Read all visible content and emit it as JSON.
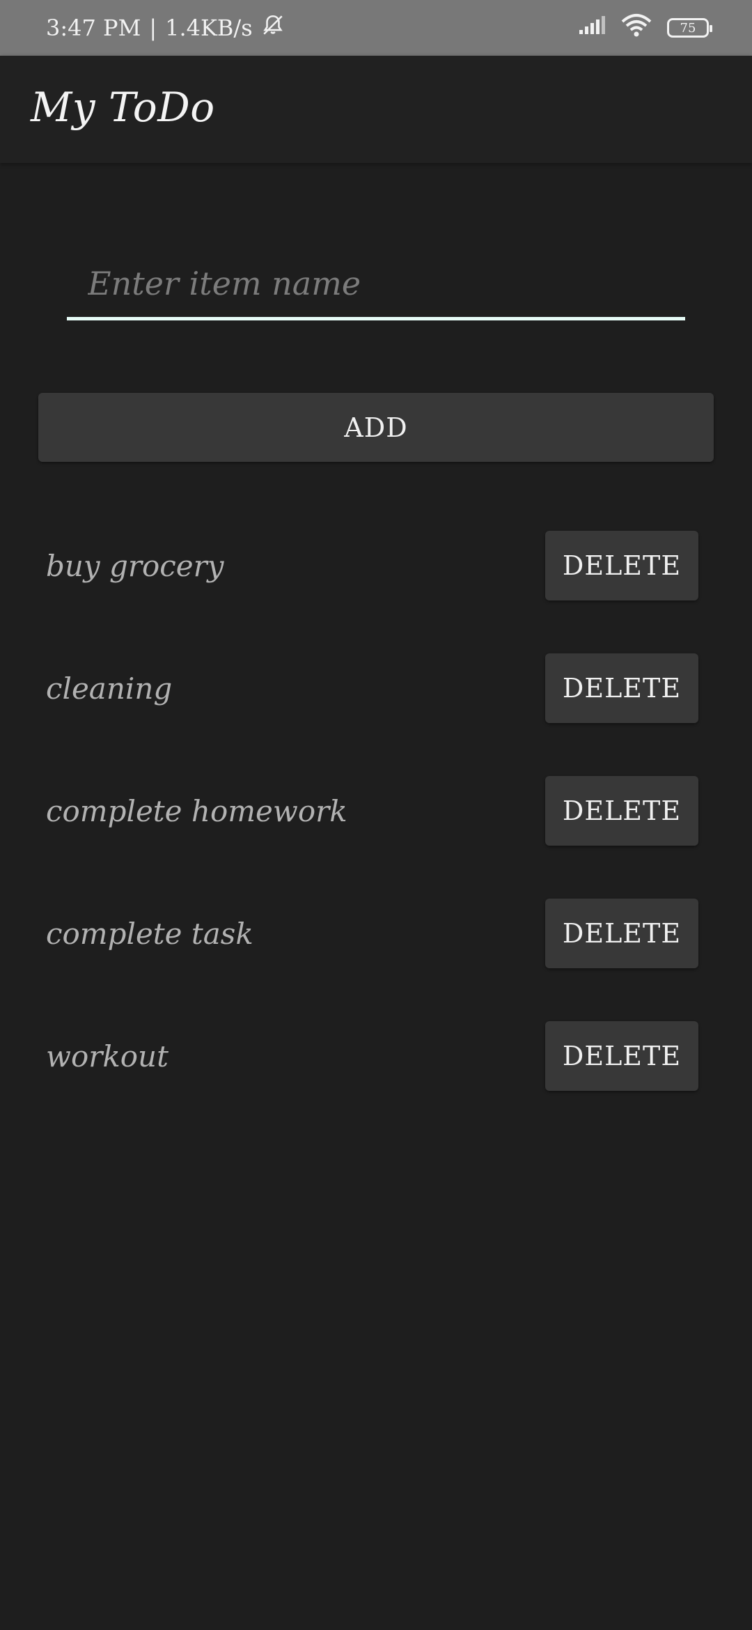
{
  "status_bar": {
    "time": "3:47 PM",
    "network_speed": "1.4KB/s",
    "separator": "|",
    "battery_level": "75",
    "icons": [
      "bell-off-icon",
      "signal-icon",
      "wifi-icon",
      "battery-icon"
    ]
  },
  "app_bar": {
    "title": "My ToDo"
  },
  "input": {
    "value": "",
    "placeholder": "Enter item name"
  },
  "add_button": {
    "label": "ADD"
  },
  "items": [
    {
      "label": "buy grocery",
      "delete_label": "DELETE"
    },
    {
      "label": "cleaning",
      "delete_label": "DELETE"
    },
    {
      "label": "complete homework",
      "delete_label": "DELETE"
    },
    {
      "label": "complete task",
      "delete_label": "DELETE"
    },
    {
      "label": "workout",
      "delete_label": "DELETE"
    }
  ],
  "colors": {
    "background": "#1e1e1e",
    "status_bar": "#787878",
    "app_bar": "#212121",
    "button": "#383838",
    "input_underline": "#e6fbf6"
  }
}
